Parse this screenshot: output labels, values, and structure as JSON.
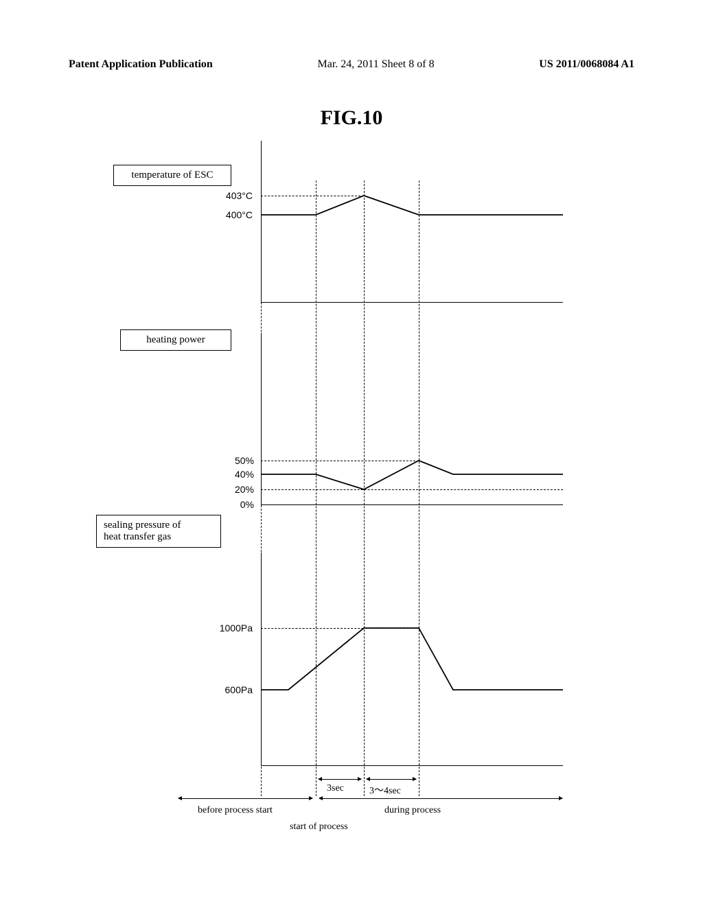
{
  "header": {
    "left": "Patent Application Publication",
    "center": "Mar. 24, 2011  Sheet 8 of 8",
    "right": "US 2011/0068084 A1"
  },
  "figure_title": "FIG.10",
  "labels": {
    "box1": "temperature of ESC",
    "box2": "heating power",
    "box3": "sealing pressure of\nheat transfer gas"
  },
  "ticks": {
    "t403": "403°C",
    "t400": "400°C",
    "h50": "50%",
    "h40": "40%",
    "h20": "20%",
    "h0": "0%",
    "p1000": "1000Pa",
    "p600": "600Pa"
  },
  "xlabels": {
    "t3": "3sec",
    "t34": "3～4sec",
    "before": "before process start",
    "start": "start of process",
    "during": "during process"
  },
  "chart_data": [
    {
      "type": "line",
      "title": "temperature of ESC",
      "ylabel": "",
      "y_ticks": [
        400,
        403
      ],
      "series": [
        {
          "name": "ESC temp",
          "points": [
            {
              "phase": "before",
              "value": 400
            },
            {
              "phase": "start",
              "value": 400
            },
            {
              "phase": "+3sec",
              "value": 403
            },
            {
              "phase": "+3~4sec_end",
              "value": 400
            },
            {
              "phase": "during",
              "value": 400
            }
          ]
        }
      ]
    },
    {
      "type": "line",
      "title": "heating power",
      "ylabel": "",
      "y_ticks": [
        0,
        20,
        40,
        50
      ],
      "series": [
        {
          "name": "power",
          "points": [
            {
              "phase": "before",
              "value": 40
            },
            {
              "phase": "start",
              "value": 40
            },
            {
              "phase": "+3sec",
              "value": 20
            },
            {
              "phase": "+3~4sec_end",
              "value": 50
            },
            {
              "phase": "during",
              "value": 40
            }
          ]
        }
      ]
    },
    {
      "type": "line",
      "title": "sealing pressure of heat transfer gas",
      "ylabel": "",
      "y_ticks": [
        600,
        1000
      ],
      "series": [
        {
          "name": "pressure",
          "points": [
            {
              "phase": "before",
              "value": 600
            },
            {
              "phase": "start_minus",
              "value": 600
            },
            {
              "phase": "+3sec",
              "value": 1000
            },
            {
              "phase": "+3~4sec_end",
              "value": 1000
            },
            {
              "phase": "during",
              "value": 600
            }
          ]
        }
      ]
    }
  ]
}
